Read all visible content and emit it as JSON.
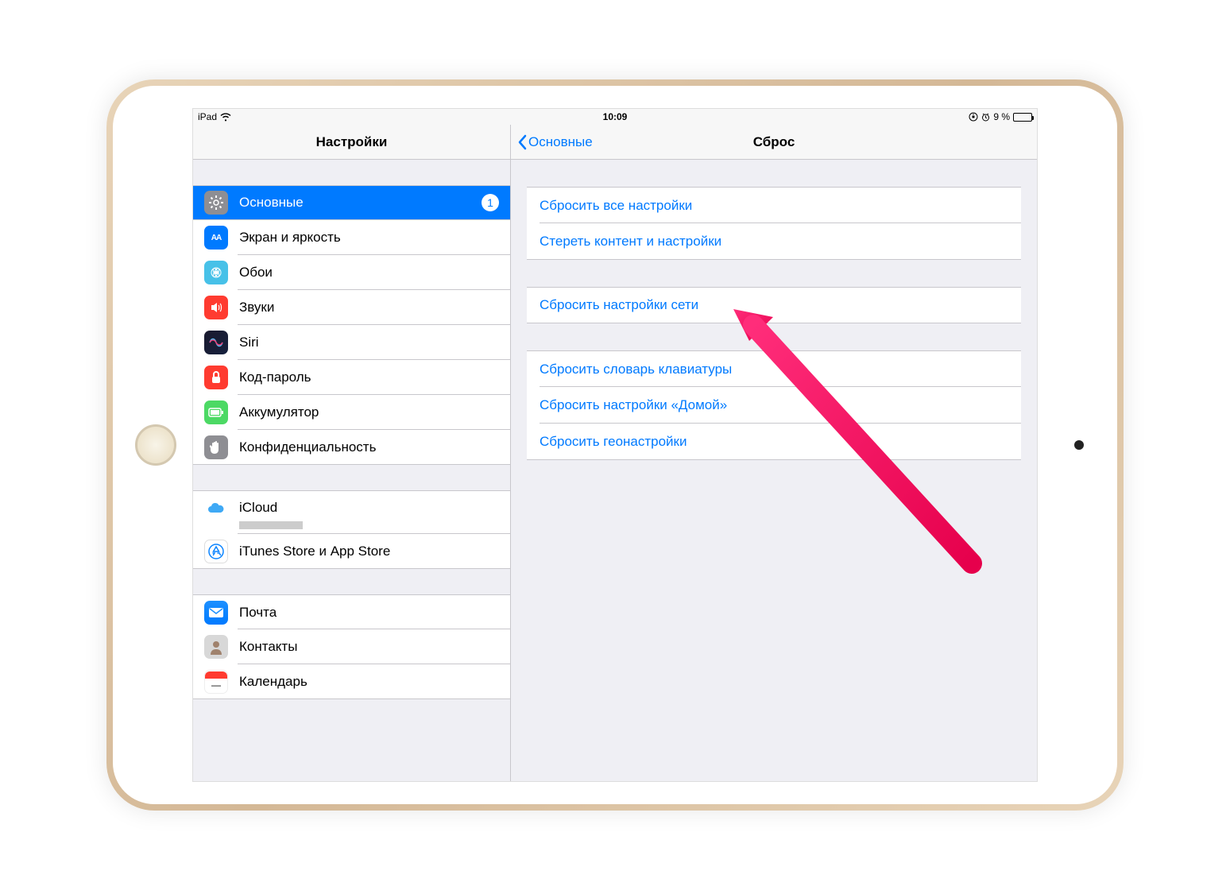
{
  "statusbar": {
    "device": "iPad",
    "time": "10:09",
    "battery_text": "9 %"
  },
  "sidebar": {
    "title": "Настройки",
    "groups": [
      {
        "items": [
          {
            "key": "general",
            "label": "Основные",
            "badge": "1",
            "selected": true
          },
          {
            "key": "display",
            "label": "Экран и яркость"
          },
          {
            "key": "wallpaper",
            "label": "Обои"
          },
          {
            "key": "sounds",
            "label": "Звуки"
          },
          {
            "key": "siri",
            "label": "Siri"
          },
          {
            "key": "passcode",
            "label": "Код-пароль"
          },
          {
            "key": "battery",
            "label": "Аккумулятор"
          },
          {
            "key": "privacy",
            "label": "Конфиденциальность"
          }
        ]
      },
      {
        "items": [
          {
            "key": "icloud",
            "label": "iCloud"
          },
          {
            "key": "itunes",
            "label": "iTunes Store и App Store"
          }
        ]
      },
      {
        "items": [
          {
            "key": "mail",
            "label": "Почта"
          },
          {
            "key": "contacts",
            "label": "Контакты"
          },
          {
            "key": "calendar",
            "label": "Календарь"
          }
        ]
      }
    ]
  },
  "detail": {
    "back_label": "Основные",
    "title": "Сброс",
    "groups": [
      [
        "Сбросить все настройки",
        "Стереть контент и настройки"
      ],
      [
        "Сбросить настройки сети"
      ],
      [
        "Сбросить словарь клавиатуры",
        "Сбросить настройки «Домой»",
        "Сбросить геонастройки"
      ]
    ]
  }
}
